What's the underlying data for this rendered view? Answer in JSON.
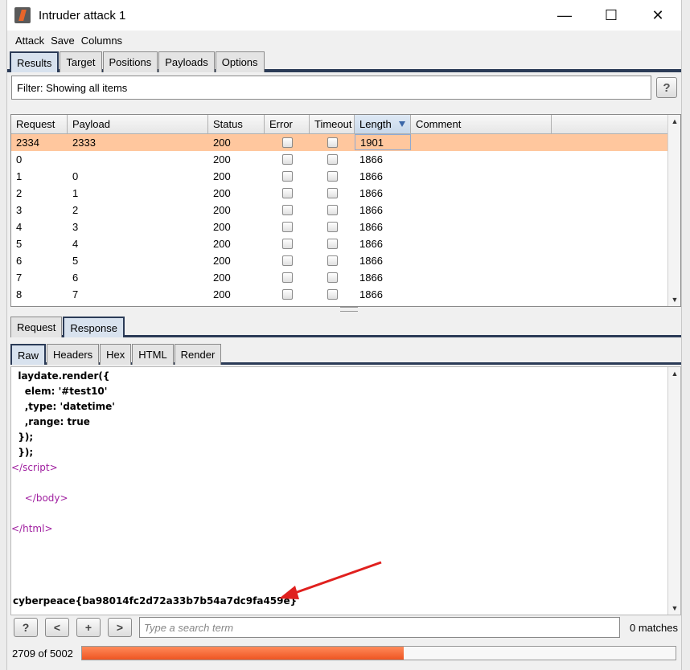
{
  "window": {
    "title": "Intruder attack 1"
  },
  "menu": [
    "Attack",
    "Save",
    "Columns"
  ],
  "tabs": [
    {
      "label": "Results",
      "active": true
    },
    {
      "label": "Target",
      "active": false
    },
    {
      "label": "Positions",
      "active": false
    },
    {
      "label": "Payloads",
      "active": false
    },
    {
      "label": "Options",
      "active": false
    }
  ],
  "filter": {
    "text": "Filter: Showing all items",
    "help": "?"
  },
  "table": {
    "columns": [
      "Request",
      "Payload",
      "Status",
      "Error",
      "Timeout",
      "Length",
      "Comment"
    ],
    "sorted_column": "Length",
    "rows": [
      {
        "request": "2334",
        "payload": "2333",
        "status": "200",
        "length": "1901",
        "selected": true
      },
      {
        "request": "0",
        "payload": "",
        "status": "200",
        "length": "1866"
      },
      {
        "request": "1",
        "payload": "0",
        "status": "200",
        "length": "1866"
      },
      {
        "request": "2",
        "payload": "1",
        "status": "200",
        "length": "1866"
      },
      {
        "request": "3",
        "payload": "2",
        "status": "200",
        "length": "1866"
      },
      {
        "request": "4",
        "payload": "3",
        "status": "200",
        "length": "1866"
      },
      {
        "request": "5",
        "payload": "4",
        "status": "200",
        "length": "1866"
      },
      {
        "request": "6",
        "payload": "5",
        "status": "200",
        "length": "1866"
      },
      {
        "request": "7",
        "payload": "6",
        "status": "200",
        "length": "1866"
      },
      {
        "request": "8",
        "payload": "7",
        "status": "200",
        "length": "1866"
      }
    ]
  },
  "detail_tabs": [
    {
      "label": "Request",
      "active": false
    },
    {
      "label": "Response",
      "active": true
    }
  ],
  "view_tabs": [
    {
      "label": "Raw",
      "active": true
    },
    {
      "label": "Headers",
      "active": false
    },
    {
      "label": "Hex",
      "active": false
    },
    {
      "label": "HTML",
      "active": false
    },
    {
      "label": "Render",
      "active": false
    }
  ],
  "response": {
    "lines": [
      {
        "text": "  laydate.render({",
        "kind": "js"
      },
      {
        "text": "    elem: '#test10'",
        "kind": "js"
      },
      {
        "text": "    ,type: 'datetime'",
        "kind": "js"
      },
      {
        "text": "    ,range: true",
        "kind": "js"
      },
      {
        "text": "  });",
        "kind": "js"
      },
      {
        "text": "  });",
        "kind": "js"
      },
      {
        "text": "script",
        "kind": "close-tag",
        "indent": ""
      },
      {
        "text": "",
        "kind": "blank"
      },
      {
        "text": "body",
        "kind": "close-tag",
        "indent": "    "
      },
      {
        "text": "",
        "kind": "blank"
      },
      {
        "text": "html",
        "kind": "close-tag",
        "indent": ""
      }
    ],
    "flag": "cyberpeace{ba98014fc2d72a33b7b54a7dc9fa459e}"
  },
  "search": {
    "placeholder": "Type a search term",
    "buttons": [
      "?",
      "<",
      "+",
      ">"
    ],
    "matches": "0 matches"
  },
  "status": {
    "progress_text": "2709 of 5002",
    "progress_fraction": 0.5416
  },
  "colors": {
    "selected_row": "#ffc79e",
    "progress": "#ee5522",
    "tag": "#a020a0",
    "arrow": "#e0201e"
  }
}
